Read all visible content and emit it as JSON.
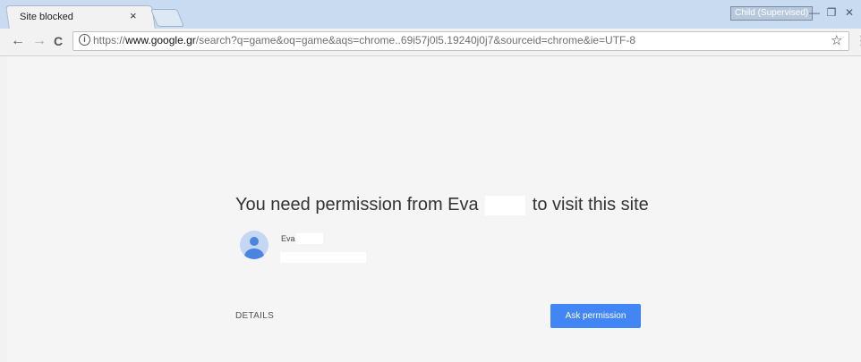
{
  "window": {
    "profile_label": "Child (Supervised)",
    "minimize_glyph": "—",
    "restore_glyph": "❐",
    "close_glyph": "✕"
  },
  "tab": {
    "title": "Site blocked",
    "close_glyph": "×"
  },
  "toolbar": {
    "back_glyph": "←",
    "forward_glyph": "→",
    "reload_glyph": "C",
    "info_glyph": "i",
    "url_scheme": "https://",
    "url_host": "www.google.gr",
    "url_path": "/search?q=game&oq=game&aqs=chrome..69i57j0l5.19240j0j7&sourceid=chrome&ie=UTF-8",
    "star_glyph": "☆",
    "menu_glyph": "⋮"
  },
  "page": {
    "heading_part1": "You need permission from Eva",
    "heading_part2": "to visit this site",
    "user_name": "Eva",
    "details_label": "DETAILS",
    "ask_button_label": "Ask permission"
  },
  "colors": {
    "accent": "#4285f4",
    "avatar_bg": "#c6d7f4",
    "titlebar_bg": "#c9dbf0"
  },
  "icons": [
    "info-icon",
    "star-icon",
    "menu-icon",
    "avatar-icon",
    "back-icon",
    "forward-icon",
    "reload-icon"
  ]
}
